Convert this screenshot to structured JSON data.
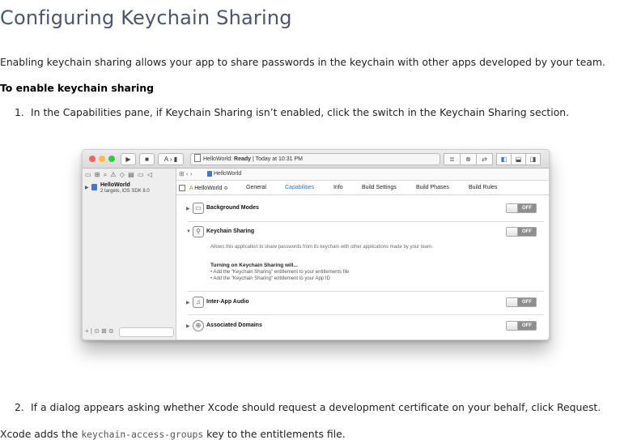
{
  "doc": {
    "title": "Configuring Keychain Sharing",
    "intro": "Enabling keychain sharing allows your app to share passwords in the keychain with other apps developed by your team.",
    "subhead": "To enable keychain sharing",
    "step1_num": "1.",
    "step1": "In the Capabilities pane, if Keychain Sharing isn’t enabled, click the switch in the Keychain Sharing section.",
    "step2_num": "2.",
    "step2": "If a dialog appears asking whether Xcode should request a development certificate on your behalf, click Request.",
    "outro_prefix": "Xcode adds the ",
    "outro_code": "keychain-access-groups",
    "outro_suffix": " key to the entitlements file."
  },
  "screenshot": {
    "status_app": "HelloWorld:",
    "status_state": "Ready",
    "status_time": "Today at 10:31 PM",
    "sidebar_project": "HelloWorld",
    "sidebar_project_sub": "2 targets, iOS SDK 8.0",
    "jumpbar_label": "HelloWorld",
    "target_label": "HelloWorld ≎",
    "tabs": [
      "General",
      "Capabilities",
      "Info",
      "Build Settings",
      "Build Phases",
      "Build Rules"
    ],
    "capabilities": [
      {
        "title": "Background Modes",
        "state": "OFF"
      },
      {
        "title": "Keychain Sharing",
        "state": "OFF"
      },
      {
        "title": "Inter-App Audio",
        "state": "OFF"
      },
      {
        "title": "Associated Domains",
        "state": "OFF"
      }
    ],
    "keychain_desc": "Allows this application to share passwords from its keychain with other applications made by your team.",
    "turning_on": "Turning on Keychain Sharing will...",
    "bullets": [
      "• Add the \"Keychain Sharing\" entitlement to your entitlements file",
      "• Add the \"Keychain Sharing\" entitlement to your App ID"
    ]
  }
}
